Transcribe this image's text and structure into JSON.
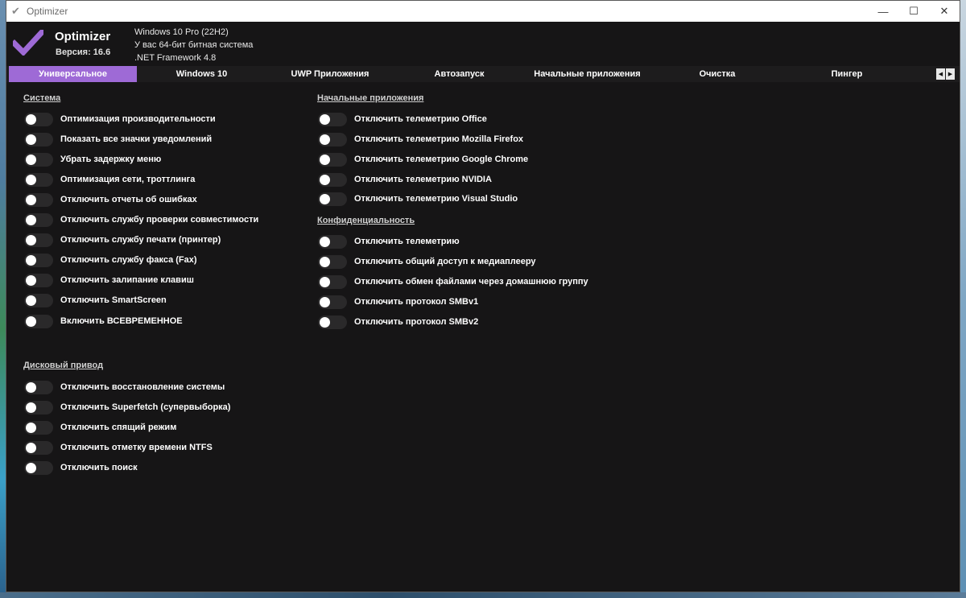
{
  "window": {
    "title": "Optimizer",
    "controls": {
      "minimize": "—",
      "maximize": "☐",
      "close": "✕"
    }
  },
  "header": {
    "app_name": "Optimizer",
    "version": "Версия: 16.6",
    "os": "Windows 10 Pro (22H2)",
    "arch": "У вас 64-бит битная система",
    "framework": ".NET Framework 4.8",
    "accent": "#9e6ad6"
  },
  "tabs": [
    {
      "label": "Универсальное",
      "active": true
    },
    {
      "label": "Windows 10",
      "active": false
    },
    {
      "label": "UWP Приложения",
      "active": false
    },
    {
      "label": "Автозапуск",
      "active": false
    },
    {
      "label": "Начальные приложения",
      "active": false
    },
    {
      "label": "Очистка",
      "active": false
    },
    {
      "label": "Пингер",
      "active": false
    }
  ],
  "tab_scroll": {
    "left": "◀",
    "right": "▶"
  },
  "sections": {
    "system": {
      "title": "Система",
      "items": [
        "Оптимизация производительности",
        "Показать все значки уведомлений",
        "Убрать задержку меню",
        "Оптимизация сети, троттлинга",
        "Отключить отчеты об ошибках",
        "Отключить службу проверки совместимости",
        "Отключить службу печати (принтер)",
        "Отключить службу факса (Fax)",
        "Отключить залипание клавиш",
        "Отключить SmartScreen",
        "Включить ВСЕВРЕМЕННОЕ"
      ]
    },
    "disk": {
      "title": "Дисковый привод",
      "items": [
        "Отключить восстановление системы",
        "Отключить Superfetch (супервыборка)",
        "Отключить спящий режим",
        "Отключить отметку времени NTFS",
        "Отключить поиск"
      ]
    },
    "startup_apps": {
      "title": "Начальные приложения",
      "items": [
        "Отключить телеметрию Office",
        "Отключить телеметрию Mozilla Firefox",
        "Отключить телеметрию Google Chrome",
        "Отключить телеметрию NVIDIA",
        "Отключить телеметрию Visual Studio"
      ]
    },
    "privacy": {
      "title": "Конфиденциальность",
      "items": [
        "Отключить телеметрию",
        "Отключить общий доступ к медиаплееру",
        "Отключить обмен файлами через домашнюю группу",
        "Отключить протокол SMBv1",
        "Отключить протокол SMBv2"
      ]
    }
  }
}
